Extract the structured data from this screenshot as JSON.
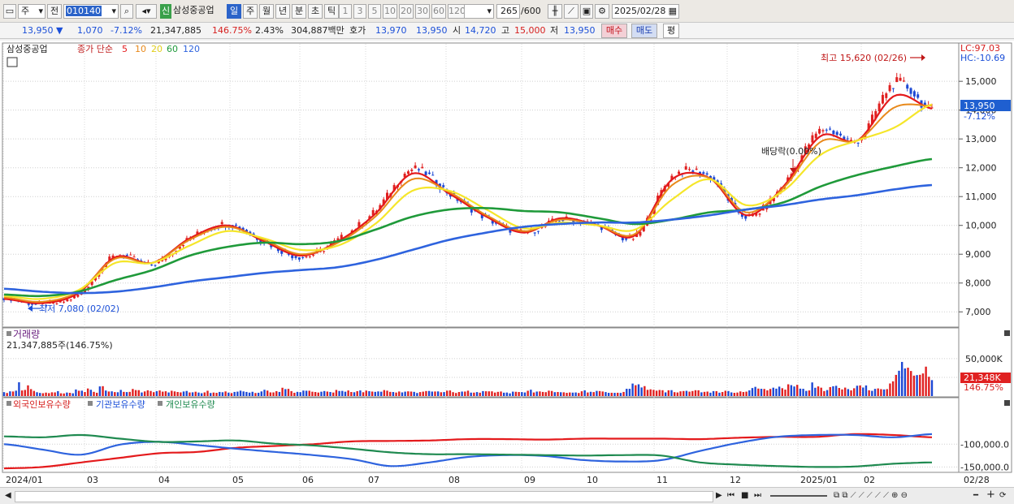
{
  "toolbar": {
    "period_sel": "주",
    "prev_label": "전",
    "code": "010140",
    "badge": "신",
    "name": "삼성중공업",
    "tabs": [
      "일",
      "주",
      "월",
      "년",
      "분",
      "초",
      "틱"
    ],
    "active_tab": "일",
    "minutes": [
      "1",
      "3",
      "5",
      "10",
      "20",
      "30",
      "60",
      "120"
    ],
    "count": "265",
    "count_max": "/600",
    "date": "2025/02/28"
  },
  "quote": {
    "price": "13,950",
    "change_arrow": "▼",
    "change": "1,070",
    "change_pct": "-7.12%",
    "volume": "21,347,885",
    "volume_ratio": "146.75%",
    "turnover_pct": "2.43%",
    "amount": "304,887백만",
    "quote_label": "호가",
    "ask": "13,970",
    "bid": "13,950",
    "open_label": "시",
    "open": "14,720",
    "high_label": "고",
    "high": "15,000",
    "low_label": "저",
    "low": "13,950",
    "buy": "매수",
    "sell": "매도",
    "eval": "평"
  },
  "main_panel": {
    "legend_name": "삼성중공업",
    "legend_ma": "종가 단순",
    "ma_periods": [
      "5",
      "10",
      "20",
      "60",
      "120"
    ],
    "lc": "LC:97.03",
    "hc": "HC:-10.69",
    "high_annot": "최고 15,620 (02/26)",
    "low_annot": "최저 7,080 (02/02)",
    "div_annot": "배당락(0.00%)",
    "price_tag": "13,950",
    "price_tag_pct": "-7.12%"
  },
  "volume_panel": {
    "title": "거래량",
    "value": "21,347,885주(146.75%)",
    "tag": "21,348K",
    "tag_pct": "146.75%"
  },
  "holding_panel": {
    "legend": [
      "외국인보유수량",
      "기관보유수량",
      "개인보유수량"
    ]
  },
  "colors": {
    "ma5": "#e41a1c",
    "ma10": "#e8891a",
    "ma20": "#f5e62a",
    "ma60": "#1f9a3a",
    "ma120": "#2e63de",
    "up": "#e02020",
    "down": "#1c48d4",
    "foreign": "#2e63de",
    "inst": "#1f8a50",
    "indiv": "#e41a1c"
  },
  "chart_data": [
    {
      "type": "line",
      "title": "",
      "ylim": [
        6500,
        16300
      ],
      "y_ticks": [
        "15,000",
        "14,000",
        "13,000",
        "12,000",
        "11,000",
        "10,000",
        "9,000",
        "8,000",
        "7,000"
      ],
      "x_ticks": [
        "2024/01",
        "03",
        "04",
        "05",
        "06",
        "07",
        "08",
        "09",
        "10",
        "11",
        "12",
        "2025/01",
        "02",
        "02/28"
      ],
      "x": [
        "2024-01",
        "02",
        "03",
        "04",
        "05",
        "06",
        "07",
        "08",
        "09",
        "10",
        "11",
        "12",
        "2025-01",
        "02",
        "02-28"
      ],
      "series": [
        {
          "name": "종가",
          "values": [
            7500,
            7250,
            7600,
            8950,
            8650,
            9550,
            10050,
            9450,
            8900,
            9500,
            10500,
            11950,
            11100,
            10250,
            9750,
            10200,
            10000,
            9600,
            11700,
            11700,
            10300,
            11400,
            13300,
            12950,
            14950,
            13950
          ]
        },
        {
          "name": "5",
          "values": [
            7450,
            7300,
            7650,
            8900,
            8700,
            9550,
            10000,
            9450,
            8950,
            9450,
            10400,
            11800,
            11100,
            10300,
            9750,
            10250,
            10000,
            9650,
            11600,
            11650,
            10350,
            11350,
            13100,
            12950,
            14500,
            14050
          ]
        },
        {
          "name": "10",
          "values": [
            7500,
            7350,
            7700,
            8850,
            8700,
            9500,
            9950,
            9500,
            9000,
            9400,
            10300,
            11600,
            11150,
            10350,
            9800,
            10200,
            10000,
            9700,
            11400,
            11650,
            10450,
            11300,
            12900,
            12950,
            14100,
            14150
          ]
        },
        {
          "name": "20",
          "values": [
            7550,
            7450,
            7750,
            8700,
            8700,
            9300,
            9800,
            9550,
            9150,
            9300,
            10050,
            11200,
            11200,
            10550,
            9900,
            10100,
            10000,
            9850,
            10900,
            11600,
            10700,
            11200,
            12450,
            12950,
            13400,
            14200
          ]
        },
        {
          "name": "60",
          "values": [
            7600,
            7550,
            7700,
            8100,
            8450,
            8950,
            9250,
            9400,
            9350,
            9450,
            9850,
            10300,
            10550,
            10600,
            10500,
            10450,
            10250,
            10050,
            10200,
            10450,
            10550,
            10800,
            11350,
            11750,
            12050,
            12300
          ]
        },
        {
          "name": "120",
          "values": [
            7800,
            7700,
            7650,
            7700,
            7850,
            8050,
            8200,
            8350,
            8450,
            8550,
            8800,
            9150,
            9500,
            9750,
            9950,
            10050,
            10100,
            10100,
            10200,
            10350,
            10550,
            10700,
            10900,
            11050,
            11250,
            11400
          ]
        }
      ]
    },
    {
      "type": "bar",
      "title": "거래량",
      "ylim": [
        0,
        90000
      ],
      "y_ticks": [
        "50,000K",
        "25,000K"
      ],
      "values": [
        5200,
        4100,
        6300,
        6100,
        7200,
        18400,
        7500,
        8200,
        14300,
        9300,
        6900,
        5100,
        4200,
        3800,
        4600,
        3900,
        5000,
        4900,
        6600,
        3700,
        3500,
        4700,
        4300,
        3700,
        8800,
        7100,
        7200,
        5400,
        10100,
        8400,
        5600,
        4400,
        12900,
        13200,
        7400,
        6100,
        6300,
        5300,
        5100,
        8200,
        5600,
        5300,
        5600,
        9500,
        8000,
        7900,
        4800,
        6200,
        7700,
        6800,
        5200,
        6600,
        7500,
        5900,
        6400,
        4800,
        7100,
        6200,
        5400,
        4900,
        6100,
        6800,
        4800,
        5000,
        5800,
        4700,
        3800,
        4900,
        7100,
        4100,
        4700,
        4300,
        5500,
        5100,
        6200,
        4600,
        4000,
        5500,
        5900,
        7200,
        6200,
        5500,
        4600,
        5700,
        4100,
        4400,
        6200,
        8400,
        7300,
        4900,
        4900,
        6500,
        5500,
        11100,
        9300,
        9600,
        6600,
        4400,
        5600,
        5200,
        7300,
        7100,
        7100,
        5800,
        5400,
        4700,
        5800,
        6700,
        6000,
        5400,
        4700,
        8200,
        6800,
        6900,
        5800,
        7500,
        5400,
        5100,
        6500,
        7500,
        5100,
        7300,
        6500,
        6000,
        5600,
        6200,
        5800,
        8000,
        7200,
        5600,
        5400,
        4700,
        6100,
        4900,
        5900,
        6300,
        6000,
        5600,
        4100,
        5300,
        5900,
        6700,
        6800,
        6000,
        6100,
        6200,
        5100,
        5300,
        7200,
        7500,
        5200,
        4100,
        5400,
        6000,
        6000,
        7200,
        4600,
        4600,
        5300,
        4500,
        6600,
        6400,
        6300,
        6300,
        4700,
        5600,
        6100,
        4500,
        4700,
        3600,
        5900,
        5700,
        5400,
        5300,
        4800,
        7100,
        8500,
        4800,
        6000,
        6200,
        5500,
        5200,
        7200,
        6800,
        5200,
        5400,
        5100,
        5000,
        4300,
        4800,
        4600,
        4800,
        4100,
        6400,
        7600,
        4800,
        5700,
        5300,
        6900,
        6700,
        6100,
        5300,
        4300,
        4400,
        4300,
        4400,
        4200,
        5500,
        9700,
        9700,
        16700,
        14500,
        15700,
        11500,
        13300,
        8300,
        9000,
        8300,
        7200,
        8100,
        7800,
        4900,
        7700,
        7900,
        5200,
        4800,
        6300,
        6700,
        7000,
        5900,
        6700,
        7800,
        7700,
        5000,
        5600,
        6000,
        4500,
        6600,
        6500,
        4500,
        5400,
        7100,
        6700,
        4900,
        4300,
        4700,
        6200,
        5400,
        5900,
        7600,
        10700,
        12300,
        10000,
        9700,
        9500,
        7600,
        9500,
        11200,
        9900,
        12600,
        10500,
        8600,
        15700,
        14600,
        12800,
        15000,
        9900,
        9700,
        6900,
        7500,
        18200,
        11100,
        12900,
        11200,
        6700,
        8000,
        12000,
        13100,
        13700,
        10800,
        8900,
        11300,
        9300,
        7600,
        10400,
        13800,
        14200,
        11400,
        14200,
        7700,
        7000,
        9600,
        10200,
        9300,
        8800,
        9300,
        16800,
        19700,
        28300,
        33800,
        45600,
        36900,
        37900,
        33500,
        27300,
        28000,
        28400,
        30200,
        39300,
        25800,
        21300
      ]
    },
    {
      "type": "line",
      "title": "",
      "ylim": [
        -160000,
        0
      ],
      "y_ticks": [
        "-100,000.0",
        "-150,000.0"
      ],
      "series": [
        {
          "name": "외국인보유수량",
          "values": [
            -153000,
            -150000,
            -140000,
            -130000,
            -120000,
            -117000,
            -108000,
            -104000,
            -100000,
            -94000,
            -93000,
            -92000,
            -89000,
            -89000,
            -90000,
            -88000,
            -88000,
            -88000,
            -89000,
            -86000,
            -84000,
            -84000,
            -78000,
            -80000,
            -85000
          ]
        },
        {
          "name": "기관보유수량",
          "values": [
            -100000,
            -112000,
            -123000,
            -101000,
            -95000,
            -102000,
            -110000,
            -117000,
            -124000,
            -133000,
            -148000,
            -140000,
            -128000,
            -124000,
            -126000,
            -135000,
            -138000,
            -135000,
            -115000,
            -97000,
            -84000,
            -80000,
            -80000,
            -85000,
            -78000
          ]
        },
        {
          "name": "개인보유수량",
          "values": [
            -83000,
            -85000,
            -80000,
            -88000,
            -95000,
            -94000,
            -92000,
            -99000,
            -103000,
            -110000,
            -118000,
            -122000,
            -122000,
            -123000,
            -124000,
            -125000,
            -124000,
            -125000,
            -140000,
            -145000,
            -148000,
            -150000,
            -149000,
            -143000,
            -140000
          ]
        }
      ]
    }
  ]
}
